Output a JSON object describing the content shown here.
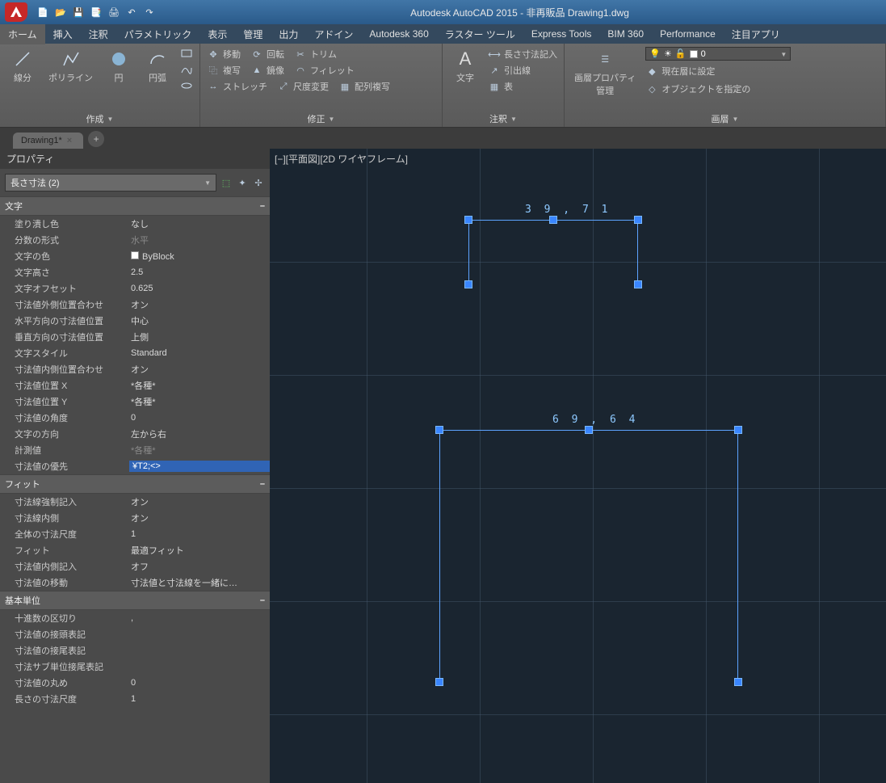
{
  "title": "Autodesk AutoCAD 2015 - 非再販品    Drawing1.dwg",
  "ribbon_tabs": [
    "ホーム",
    "挿入",
    "注釈",
    "パラメトリック",
    "表示",
    "管理",
    "出力",
    "アドイン",
    "Autodesk 360",
    "ラスター ツール",
    "Express Tools",
    "BIM 360",
    "Performance",
    "注目アプリ"
  ],
  "panels": {
    "create": {
      "title": "作成",
      "line": "線分",
      "polyline": "ポリライン",
      "circle": "円",
      "arc": "円弧"
    },
    "modify": {
      "title": "修正",
      "move": "移動",
      "copy": "複写",
      "stretch": "ストレッチ",
      "rotate": "回転",
      "mirror": "鏡像",
      "scale": "尺度変更",
      "trim": "トリム",
      "fillet": "フィレット",
      "array": "配列複写"
    },
    "text": {
      "title": "注釈",
      "label": "文字",
      "dimlinear": "長さ寸法記入",
      "leader": "引出線",
      "table": "表"
    },
    "layers": {
      "title": "画層",
      "mgr": "画層プロパティ\n管理",
      "current": "0",
      "setcurrent": "現在層に設定",
      "select": "オブジェクトを指定の"
    }
  },
  "file_tab": "Drawing1*",
  "properties": {
    "title": "プロパティ",
    "selection": "長さ寸法 (2)",
    "sections": {
      "text": {
        "title": "文字",
        "rows": [
          {
            "label": "塗り潰し色",
            "value": "なし"
          },
          {
            "label": "分数の形式",
            "value": "水平",
            "dim": true
          },
          {
            "label": "文字の色",
            "value": "ByBlock",
            "swatch": true
          },
          {
            "label": "文字高さ",
            "value": "2.5"
          },
          {
            "label": "文字オフセット",
            "value": "0.625"
          },
          {
            "label": "寸法値外側位置合わせ",
            "value": "オン"
          },
          {
            "label": "水平方向の寸法値位置",
            "value": "中心"
          },
          {
            "label": "垂直方向の寸法値位置",
            "value": "上側"
          },
          {
            "label": "文字スタイル",
            "value": "Standard"
          },
          {
            "label": "寸法値内側位置合わせ",
            "value": "オン"
          },
          {
            "label": "寸法値位置 X",
            "value": "*各種*"
          },
          {
            "label": "寸法値位置 Y",
            "value": "*各種*"
          },
          {
            "label": "寸法値の角度",
            "value": "0"
          },
          {
            "label": "文字の方向",
            "value": "左から右"
          },
          {
            "label": "計測値",
            "value": "*各種*",
            "dim": true
          },
          {
            "label": "寸法値の優先",
            "value": "¥T2;<>",
            "edit": true
          }
        ]
      },
      "fit": {
        "title": "フィット",
        "rows": [
          {
            "label": "寸法線強制記入",
            "value": "オン"
          },
          {
            "label": "寸法線内側",
            "value": "オン"
          },
          {
            "label": "全体の寸法尺度",
            "value": "1"
          },
          {
            "label": "フィット",
            "value": "最適フィット"
          },
          {
            "label": "寸法値内側記入",
            "value": "オフ"
          },
          {
            "label": "寸法値の移動",
            "value": "寸法値と寸法線を一緒に…"
          }
        ]
      },
      "units": {
        "title": "基本単位",
        "rows": [
          {
            "label": "十進数の区切り",
            "value": ","
          },
          {
            "label": "寸法値の接頭表記",
            "value": ""
          },
          {
            "label": "寸法値の接尾表記",
            "value": ""
          },
          {
            "label": "寸法サブ単位接尾表記",
            "value": ""
          },
          {
            "label": "寸法値の丸め",
            "value": "0"
          },
          {
            "label": "長さの寸法尺度",
            "value": "1"
          }
        ]
      }
    }
  },
  "viewport": {
    "label": "[−][平面図][2D ワイヤフレーム]",
    "dim1": "3 9 , 7 1",
    "dim2": "6 9 , 6 4"
  }
}
